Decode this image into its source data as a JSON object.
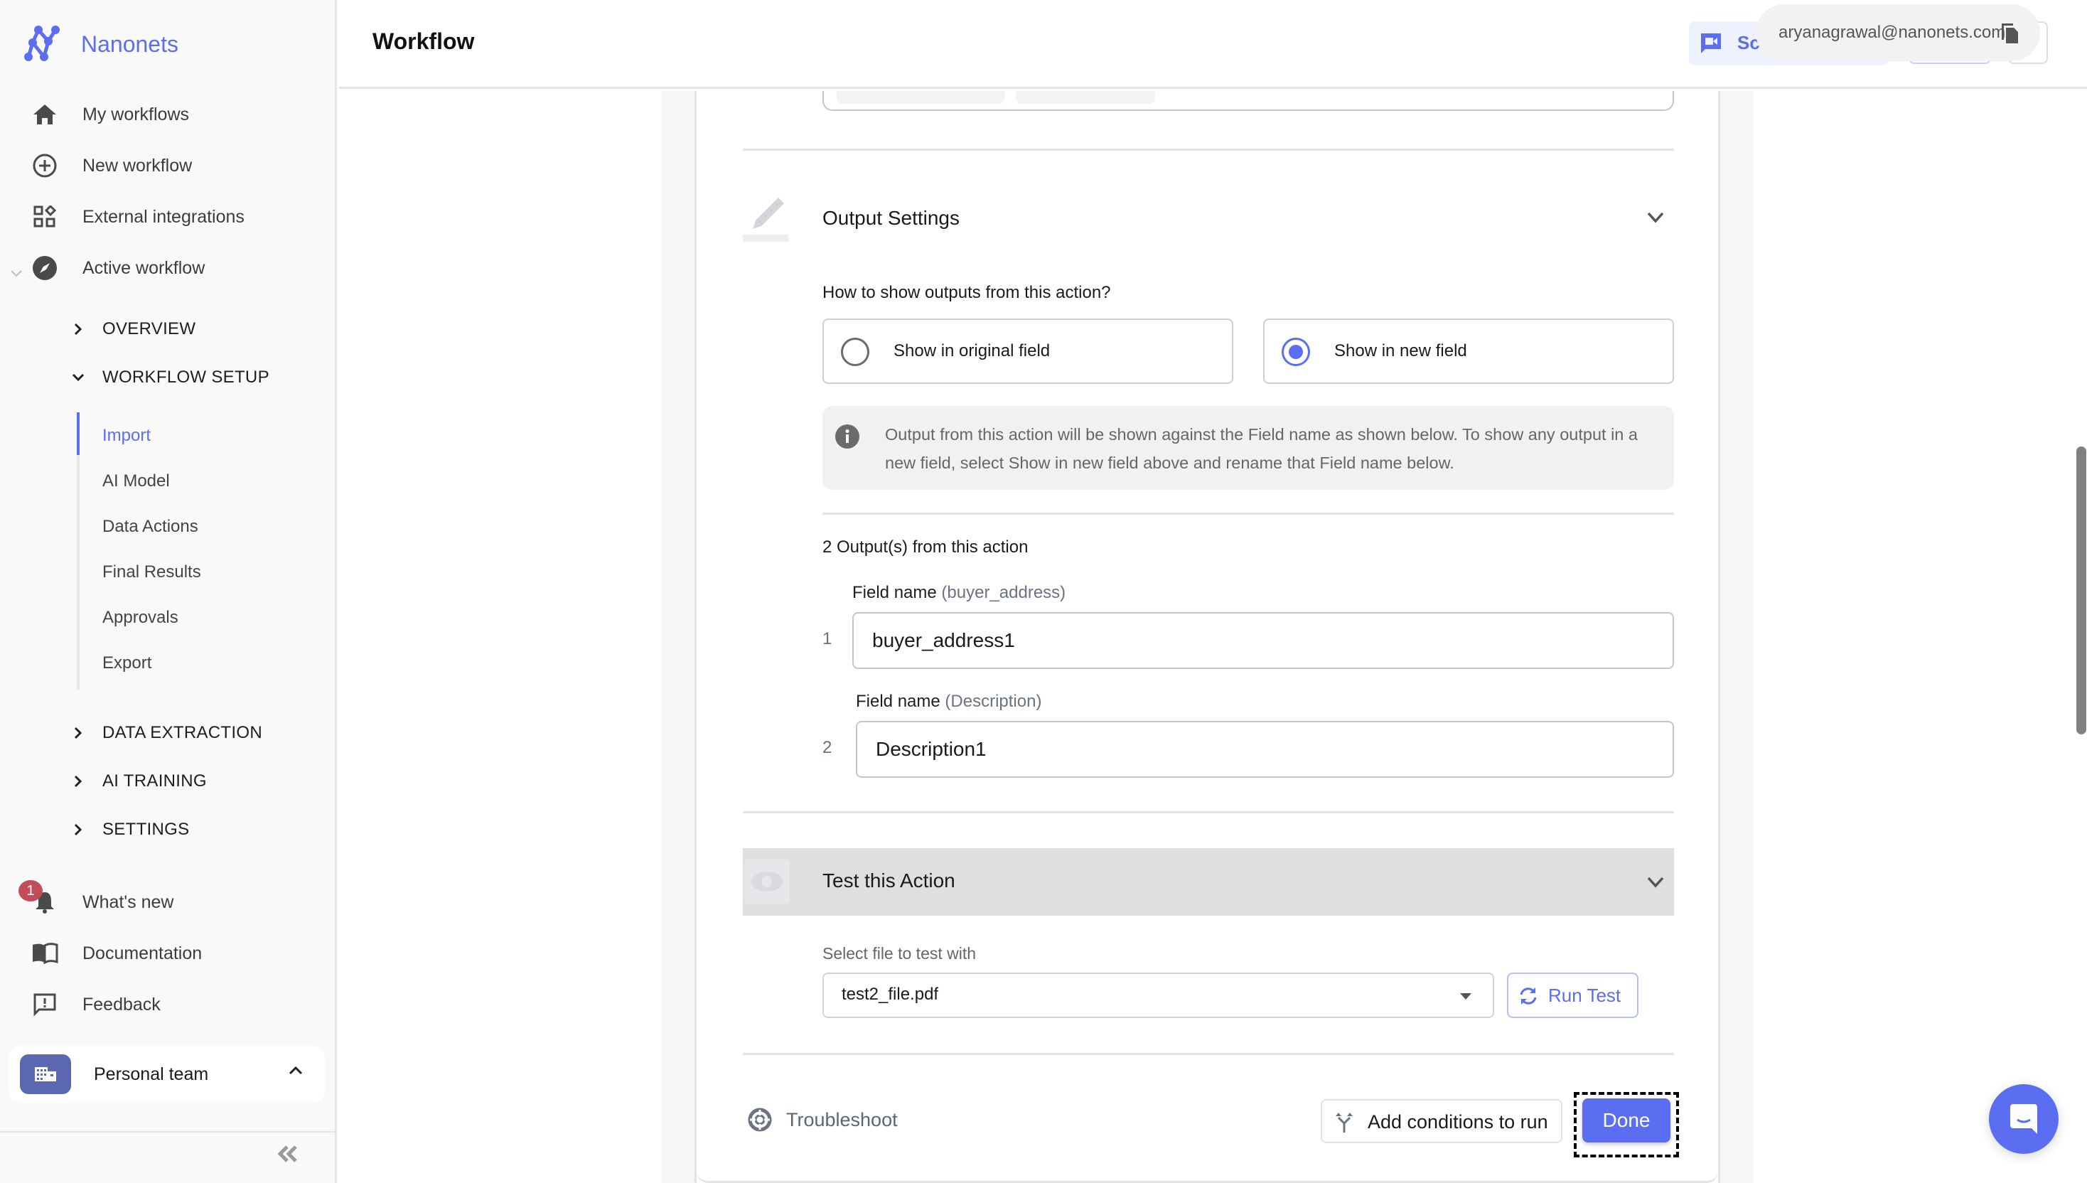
{
  "brand": {
    "name": "Nanonets",
    "color": "#5b6ef2"
  },
  "sidebar": {
    "main_items": [
      {
        "label": "My workflows",
        "icon": "home-icon"
      },
      {
        "label": "New workflow",
        "icon": "add-circle-icon"
      },
      {
        "label": "External integrations",
        "icon": "widgets-icon"
      },
      {
        "label": "Active workflow",
        "icon": "compass-icon",
        "expanded": true
      }
    ],
    "sections": [
      {
        "label": "OVERVIEW",
        "expanded": false
      },
      {
        "label": "WORKFLOW SETUP",
        "expanded": true
      },
      {
        "label": "DATA EXTRACTION",
        "expanded": false
      },
      {
        "label": "AI TRAINING",
        "expanded": false
      },
      {
        "label": "SETTINGS",
        "expanded": false
      }
    ],
    "setup_items": [
      {
        "label": "Import",
        "active": true
      },
      {
        "label": "AI Model",
        "active": false
      },
      {
        "label": "Data Actions",
        "active": false
      },
      {
        "label": "Final Results",
        "active": false
      },
      {
        "label": "Approvals",
        "active": false
      },
      {
        "label": "Export",
        "active": false
      }
    ],
    "bottom_items": [
      {
        "label": "What's new",
        "icon": "bell-icon",
        "badge": "1"
      },
      {
        "label": "Documentation",
        "icon": "book-icon"
      },
      {
        "label": "Feedback",
        "icon": "feedback-icon"
      }
    ],
    "team": {
      "label": "Personal team"
    }
  },
  "header": {
    "title": "Workflow",
    "schedule_label": "Sch",
    "tooltip_email": "aryanagrawal@nanonets.com"
  },
  "output_settings": {
    "title": "Output Settings",
    "question": "How to show outputs from this action?",
    "options": [
      {
        "label": "Show in original field",
        "selected": false
      },
      {
        "label": "Show in new field",
        "selected": true
      }
    ],
    "info": "Output from this action will be shown against the Field name as shown below. To show any output in a new field, select Show in new field above and rename that Field name below.",
    "outputs_count_label": "2 Output(s) from this action",
    "fields": [
      {
        "index": "1",
        "label": "Field name",
        "hint": "(buyer_address)",
        "value": "buyer_address1"
      },
      {
        "index": "2",
        "label": "Field name",
        "hint": "(Description)",
        "value": "Description1"
      }
    ]
  },
  "test_action": {
    "title": "Test this Action",
    "select_label": "Select file to test with",
    "selected_file": "test2_file.pdf",
    "run_label": "Run Test"
  },
  "footer": {
    "troubleshoot_label": "Troubleshoot",
    "conditions_label": "Add conditions to run",
    "done_label": "Done"
  }
}
